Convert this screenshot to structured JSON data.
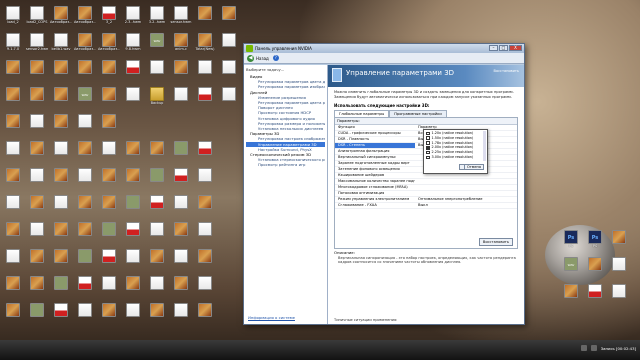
{
  "window": {
    "title": "Панель управления NVIDIA",
    "back_label": "Назад",
    "min_btn": "–",
    "max_btn": "□",
    "close_btn": "X"
  },
  "nav": {
    "select_prompt": "Выберите задачу...",
    "items": [
      {
        "kind": "cat",
        "text": "Видео"
      },
      {
        "kind": "item",
        "text": "Регулировка параметров цвета для видео"
      },
      {
        "kind": "item",
        "text": "Регулировка параметров изображения с"
      },
      {
        "kind": "cat",
        "text": "Дисплей"
      },
      {
        "kind": "item",
        "text": "Изменение разрешения"
      },
      {
        "kind": "item",
        "text": "Регулировка параметров цвета рабочего"
      },
      {
        "kind": "item",
        "text": "Поворот дисплея"
      },
      {
        "kind": "item",
        "text": "Просмотр состояния HDCP"
      },
      {
        "kind": "item",
        "text": "Установка цифрового аудио"
      },
      {
        "kind": "item",
        "text": "Регулировка размера и положения рабочего"
      },
      {
        "kind": "item",
        "text": "Установка нескольких дисплеев"
      },
      {
        "kind": "cat",
        "text": "Параметры 3D"
      },
      {
        "kind": "item",
        "text": "Регулировка настроек изображения с прос"
      },
      {
        "kind": "item",
        "text": "Управление параметрами 3D",
        "selected": true
      },
      {
        "kind": "item",
        "text": "Настройка Surround, PhysX"
      },
      {
        "kind": "cat",
        "text": "Стереоскопический режим 3D"
      },
      {
        "kind": "item",
        "text": "Установка стереоскопического режима 3D"
      },
      {
        "kind": "item",
        "text": "Просмотр рейтинга игр"
      }
    ],
    "sysinfo": "Информация о системе"
  },
  "banner": {
    "title": "Управление параметрами 3D",
    "restore": "Восстановить"
  },
  "description": "Можно изменить глобальные параметры 3D и создать замещения для конкретных программ. Замещения будут автоматически использоваться при каждом запуске указанных программ.",
  "settings_title": "Использовать следующие настройки 3D:",
  "tabs": [
    "Глобальные параметры",
    "Программные настройки"
  ],
  "grid": {
    "header_label": "Параметры:",
    "col_function": "Функция",
    "col_param": "Параметр",
    "rows": [
      {
        "k": "Функция",
        "v": "Параметр"
      },
      {
        "k": "CUDA - графические процессоры",
        "v": "Все"
      },
      {
        "k": "DSR - Плавность",
        "v": "Выкл"
      },
      {
        "k": "DSR - Степень",
        "v": "Выкл",
        "selected": true
      },
      {
        "k": "Анизотропная фильтрация",
        "v": ""
      },
      {
        "k": "Вертикальный синхроимпульс",
        "v": ""
      },
      {
        "k": "Заранее подготовленные кадры вирт",
        "v": ""
      },
      {
        "k": "Затенение фонового освещения",
        "v": ""
      },
      {
        "k": "Кэширование шейдеров",
        "v": ""
      },
      {
        "k": "Максимальное количество заранее подг",
        "v": ""
      },
      {
        "k": "Многокадровое сглаживание (MFAA)",
        "v": ""
      },
      {
        "k": "Потоковая оптимизация",
        "v": ""
      },
      {
        "k": "Режим управления электропитанием",
        "v": "Оптимальное энергопотребление"
      },
      {
        "k": "Сглаживание - FXAA",
        "v": "Выкл"
      }
    ],
    "restore_btn": "Восстановить"
  },
  "dsr_dropdown": {
    "options": [
      {
        "label": "1.20x (native resolution)",
        "checked": false
      },
      {
        "label": "1.50x (native resolution)",
        "checked": false
      },
      {
        "label": "1.78x (native resolution)",
        "checked": false
      },
      {
        "label": "2.00x (native resolution)",
        "checked": true
      },
      {
        "label": "2.25x (native resolution)",
        "checked": false
      },
      {
        "label": "3.00x (native resolution)",
        "checked": false
      }
    ],
    "ok": "OK",
    "cancel": "Отмена"
  },
  "descr": {
    "label": "Описание:",
    "text": "Вертикальная синхронизация - это набор настроек, определяющих, как частота рендеринга кадров соотносится со значением частоты обновления дисплея."
  },
  "typical": "Типичные ситуации применения:",
  "taskbar": {
    "clock": "Запись [00:02:43]"
  },
  "desktop_icons": [
    {
      "label": "load_2",
      "type": "doc"
    },
    {
      "label": "load2_COPS",
      "type": "doc"
    },
    {
      "label": "Автообраз...",
      "type": "img"
    },
    {
      "label": "Автообраз...",
      "type": "img"
    },
    {
      "label": "3_2",
      "type": "red"
    },
    {
      "label": "2.3-.hwm",
      "type": "doc"
    },
    {
      "label": "3.2-.hwm",
      "type": "doc"
    },
    {
      "label": "sensor.hwm",
      "type": "doc"
    },
    {
      "label": "",
      "type": "img"
    },
    {
      "label": "",
      "type": "img"
    },
    {
      "label": "9.1.7.0",
      "type": "doc"
    },
    {
      "label": "sensor2.hwm",
      "type": "doc"
    },
    {
      "label": "bellb1.wav",
      "type": "doc"
    },
    {
      "label": "Автообраз...",
      "type": "img"
    },
    {
      "label": "Автообраз...",
      "type": "img"
    },
    {
      "label": "9.8.hwm",
      "type": "doc"
    },
    {
      "label": "",
      "type": "wav"
    },
    {
      "label": "anim-c",
      "type": "img"
    },
    {
      "label": "Tatar(New)",
      "type": "img"
    },
    {
      "label": "",
      "type": "doc"
    },
    {
      "label": "",
      "type": "img"
    },
    {
      "label": "",
      "type": "img"
    },
    {
      "label": "",
      "type": "img"
    },
    {
      "label": "",
      "type": "img"
    },
    {
      "label": "",
      "type": "img"
    },
    {
      "label": "",
      "type": "red"
    },
    {
      "label": "",
      "type": "doc"
    },
    {
      "label": "",
      "type": "img"
    },
    {
      "label": "",
      "type": "doc"
    },
    {
      "label": "",
      "type": "doc"
    },
    {
      "label": "",
      "type": "img"
    },
    {
      "label": "",
      "type": "img"
    },
    {
      "label": "",
      "type": "img"
    },
    {
      "label": "",
      "type": "wav"
    },
    {
      "label": "",
      "type": "img"
    },
    {
      "label": "",
      "type": "doc"
    },
    {
      "label": "Backup",
      "type": "fld"
    },
    {
      "label": "",
      "type": "doc"
    },
    {
      "label": "",
      "type": "red"
    },
    {
      "label": "",
      "type": "doc"
    },
    {
      "label": "",
      "type": "img"
    },
    {
      "label": "",
      "type": "doc"
    },
    {
      "label": "",
      "type": "img"
    },
    {
      "label": "",
      "type": "doc"
    },
    {
      "label": "",
      "type": "img"
    },
    {
      "label": "PS",
      "type": "ps"
    },
    {
      "label": "PS",
      "type": "ps"
    },
    {
      "label": "",
      "type": "img"
    },
    {
      "label": "",
      "type": "wav"
    },
    {
      "label": "",
      "type": "img"
    },
    {
      "label": "",
      "type": "doc"
    },
    {
      "label": "",
      "type": "img"
    },
    {
      "label": "",
      "type": "red"
    },
    {
      "label": "",
      "type": "doc"
    }
  ]
}
